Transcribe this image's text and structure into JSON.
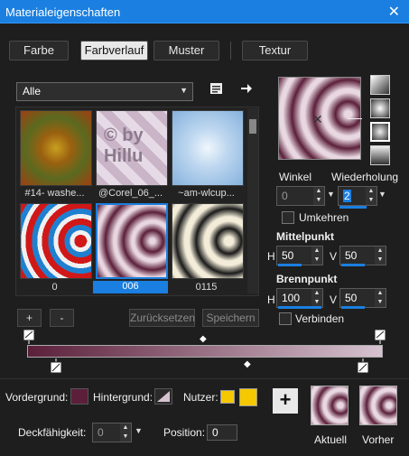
{
  "title": "Materialeigenschaften",
  "tabs": [
    "Farbe",
    "Farbverlauf",
    "Muster",
    "Textur"
  ],
  "category": "Alle",
  "swatches": [
    {
      "label": "#14- washe..."
    },
    {
      "label": "@Corel_06_..."
    },
    {
      "label": "~am-wlcup..."
    },
    {
      "label": "0"
    },
    {
      "label": "006"
    },
    {
      "label": "0115"
    }
  ],
  "watermark": "© by Hillu",
  "angle_label": "Winkel",
  "repeat_label": "Wiederholung",
  "angle_value": "0",
  "repeat_value": "2",
  "invert_label": "Umkehren",
  "center_label": "Mittelpunkt",
  "focal_label": "Brennpunkt",
  "h": "H",
  "v": "V",
  "center_h": "50",
  "center_v": "50",
  "focal_h": "100",
  "focal_v": "50",
  "link_label": "Verbinden",
  "plus": "+",
  "minus": "-",
  "reset_label": "Zurücksetzen",
  "save_label": "Speichern",
  "fg_label": "Vordergrund:",
  "bg_label": "Hintergrund:",
  "user_label": "Nutzer:",
  "opacity_label": "Deckfähigkeit:",
  "opacity_value": "0",
  "position_label": "Position:",
  "position_value": "0",
  "current_label": "Aktuell",
  "previous_label": "Vorher",
  "colors": {
    "accent": "#1a7fe0",
    "dark": "#5b1f3a",
    "light": "#d7c3d0",
    "user": "#f6c800"
  }
}
